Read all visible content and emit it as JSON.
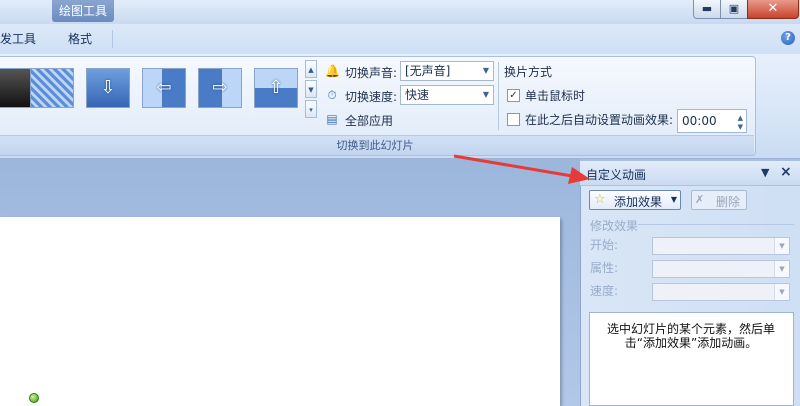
{
  "title_bar": {
    "contextual_tab": "绘图工具",
    "min_symbol": "▬",
    "max_symbol": "▣",
    "close_symbol": "✕"
  },
  "ribbon_tabs": {
    "developer": "发工具",
    "format": "格式",
    "help_symbol": "?"
  },
  "transition_group": {
    "label": "切换到此幻灯片",
    "sound_label": "切换声音:",
    "sound_value": "[无声音]",
    "speed_label": "切换速度:",
    "speed_value": "快速",
    "apply_all": "全部应用"
  },
  "advance_group": {
    "title": "换片方式",
    "on_click_label": "单击鼠标时",
    "on_click_checked": "✓",
    "after_label": "在此之后自动设置动画效果:",
    "after_value": "00:00"
  },
  "task_pane": {
    "title": "自定义动画",
    "add_effect": "添加效果",
    "remove": "删除",
    "modify_heading": "修改效果",
    "start_label": "开始:",
    "property_label": "属性:",
    "speed_label": "速度:",
    "hint": "选中幻灯片的某个元素，然后单击“添加效果”添加动画。"
  },
  "colors": {
    "ribbon_bg": "#dbe8f8",
    "pane_bg": "#d9e6f7",
    "arrow": "#e53b3b"
  }
}
